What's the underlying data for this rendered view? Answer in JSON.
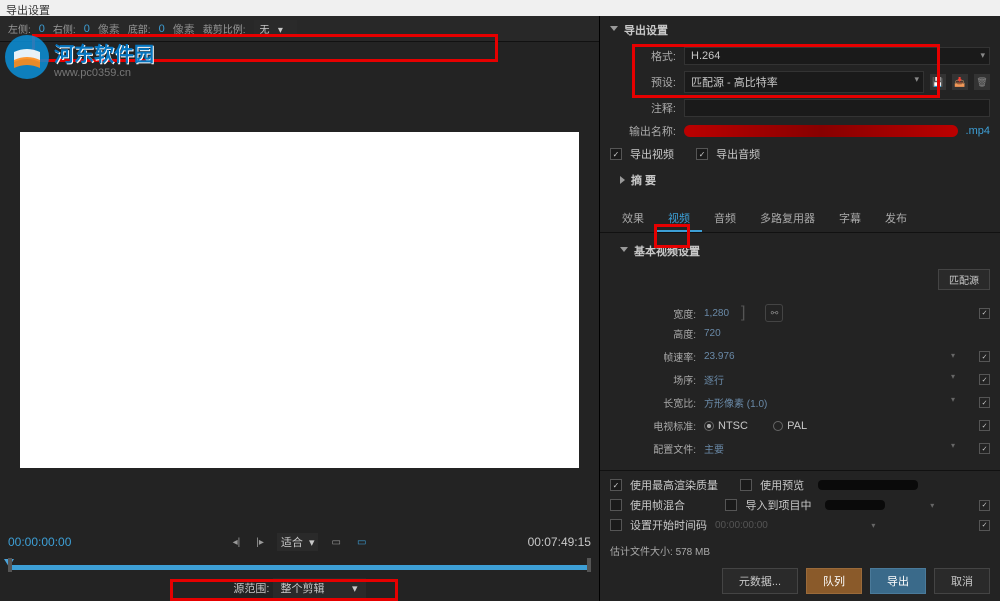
{
  "window_title": "导出设置",
  "watermark": {
    "site_cn": "河东软件园",
    "site_url": "www.pc0359.cn"
  },
  "crop_toolbar": {
    "left_label": "左侧:",
    "left_val": "0",
    "right_label": "右侧:",
    "right_val": "0",
    "bottom_label": "底部:",
    "bottom_val": "0",
    "unit": "像素",
    "ratio_label": "裁剪比例:",
    "ratio_value": "无"
  },
  "timeline": {
    "current_time": "00:00:00:00",
    "total_time": "00:07:49:15",
    "fit_label": "适合",
    "source_range_label": "源范围:",
    "source_range_value": "整个剪辑"
  },
  "export_settings": {
    "header": "导出设置",
    "format_label": "格式:",
    "format_value": "H.264",
    "preset_label": "预设:",
    "preset_value": "匹配源 - 高比特率",
    "comment_label": "注释:",
    "comment_value": "",
    "output_name_label": "输出名称:",
    "output_ext": ".mp4",
    "export_video_label": "导出视频",
    "export_audio_label": "导出音频",
    "summary_label": "摘 要"
  },
  "tabs": {
    "effects": "效果",
    "video": "视频",
    "audio": "音频",
    "multiplexer": "多路复用器",
    "subtitles": "字幕",
    "publish": "发布"
  },
  "video_settings": {
    "header": "基本视频设置",
    "match_source": "匹配源",
    "width_label": "宽度:",
    "width_value": "1,280",
    "height_label": "高度:",
    "height_value": "720",
    "fps_label": "帧速率:",
    "fps_value": "23.976",
    "order_label": "场序:",
    "order_value": "逐行",
    "aspect_label": "长宽比:",
    "aspect_value": "方形像素 (1.0)",
    "tv_label": "电视标准:",
    "tv_ntsc": "NTSC",
    "tv_pal": "PAL",
    "profile_label": "配置文件:",
    "profile_value": "主要"
  },
  "bottom_opts": {
    "max_quality": "使用最高渲染质量",
    "use_preview": "使用预览",
    "frame_blend": "使用帧混合",
    "import_project": "导入到项目中",
    "set_start_tc": "设置开始时间码",
    "start_tc_value": "00:00:00:00",
    "est_size_label": "估计文件大小:",
    "est_size_value": "578 MB"
  },
  "actions": {
    "metadata": "元数据...",
    "queue": "队列",
    "export": "导出",
    "cancel": "取消"
  }
}
